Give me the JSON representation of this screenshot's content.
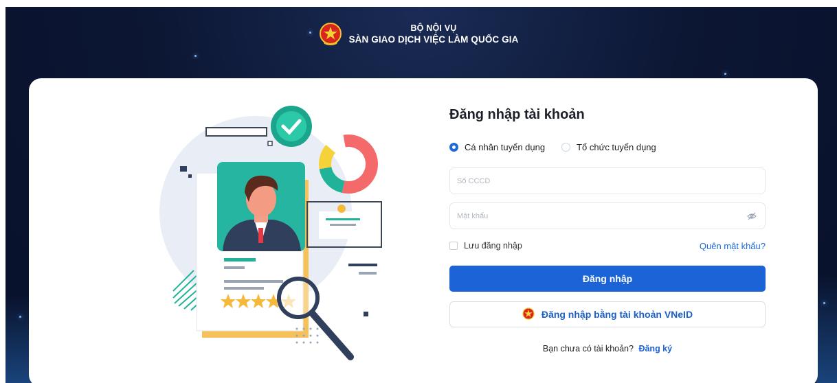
{
  "header": {
    "line1": "BỘ NỘI VỤ",
    "line2": "SÀN GIAO DỊCH VIỆC LÀM QUỐC GIA"
  },
  "login": {
    "title": "Đăng nhập tài khoản",
    "account_types": [
      {
        "label": "Cá nhân tuyển dụng",
        "selected": true
      },
      {
        "label": "Tổ chức tuyển dụng",
        "selected": false
      }
    ],
    "id_field": {
      "placeholder": "Số CCCD",
      "value": ""
    },
    "password_field": {
      "placeholder": "Mật khẩu",
      "value": ""
    },
    "remember_label": "Lưu đăng nhập",
    "remember_checked": false,
    "forgot_label": "Quên mật khẩu?",
    "submit_label": "Đăng nhập",
    "vneid_label": "Đăng nhập bằng tài khoản VNeID",
    "signup_prompt": "Bạn chưa có tài khoản?",
    "signup_link": "Đăng ký"
  },
  "illustration": {
    "rating_stars": 4.5,
    "rating_max": 5
  },
  "colors": {
    "primary": "#1b63d6",
    "background_dark": "#0c1734",
    "accent_teal": "#20b39a",
    "accent_coral": "#f46a6a",
    "accent_yellow": "#f6b93b"
  },
  "icons": {
    "emblem": "national-emblem-icon",
    "eye": "eye-slash-icon",
    "vneid": "vneid-emblem-icon"
  }
}
